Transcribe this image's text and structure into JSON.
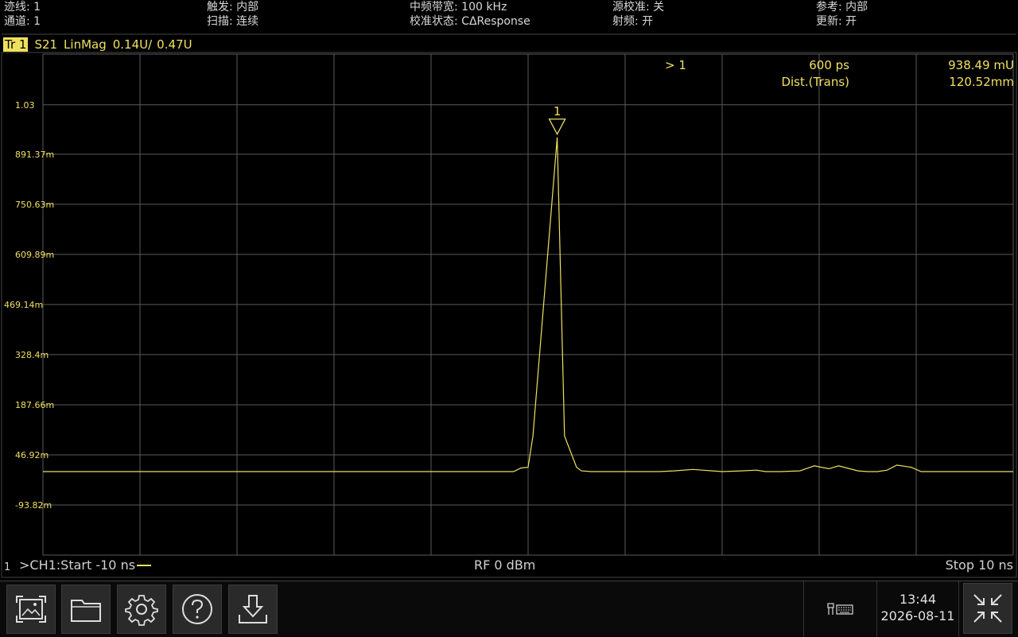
{
  "status_bar": {
    "col1": [
      "迹线: 1",
      "通道: 1"
    ],
    "col2": [
      "触发: 内部",
      "扫描: 连续"
    ],
    "col3": [
      "中频带宽: 100 kHz",
      "校准状态: CΔResponse"
    ],
    "col4": [
      "源校准: 关",
      "射频: 开"
    ],
    "col5": [
      "参考: 内部",
      "更新: 开"
    ]
  },
  "trace_header": {
    "tag": "Tr 1",
    "param": "S21",
    "format": "LinMag",
    "scale": "0.14U/",
    "ref": "0.47U"
  },
  "marker_readout": {
    "active": "> 1",
    "x": "600 ps",
    "y": "938.49 mU",
    "dist_label": "Dist.(Trans)",
    "dist_value": "120.52mm"
  },
  "footer": {
    "channel_number": "1",
    "start": ">CH1:Start -10 ns",
    "power": "RF 0 dBm",
    "stop": "Stop 10 ns"
  },
  "clock": {
    "time": "13:44",
    "date": "2026-08-11"
  },
  "colors": {
    "trace": "#f0e060",
    "grid": "#5a5a5a",
    "background": "#000000"
  },
  "icons": [
    "screenshot-icon",
    "folder-icon",
    "gear-icon",
    "help-icon",
    "download-icon",
    "keyboard-icon",
    "fullscreen-icon"
  ],
  "chart_data": {
    "type": "line",
    "xlabel": "",
    "ylabel": "",
    "xlim": [
      -10,
      10
    ],
    "x_unit": "ns",
    "ylim": [
      -0.2346,
      1.1725
    ],
    "y_unit": "U",
    "reference_value": 0.46914,
    "y_tick_labels": [
      "1.03",
      "891.37m",
      "750.63m",
      "609.89m",
      "469.14m",
      "328.4m",
      "187.66m",
      "46.92m",
      "-93.82m"
    ],
    "y_tick_values": [
      1.03,
      0.89137,
      0.75063,
      0.60989,
      0.46914,
      0.3284,
      0.18766,
      0.04692,
      -0.09382
    ],
    "grid": true,
    "series": [
      {
        "x": [
          -10,
          -0.3,
          -0.25,
          -0.15,
          0.0,
          0.1,
          0.6,
          0.75,
          1.0,
          1.1,
          1.3,
          1.5,
          2.0,
          2.4,
          2.7,
          3.0,
          3.4,
          4.0,
          4.4,
          4.7,
          4.9,
          5.2,
          5.6,
          5.9,
          6.2,
          6.4,
          6.8,
          7.0,
          7.2,
          7.4,
          7.6,
          7.9,
          8.1,
          10
        ],
        "y": [
          0,
          0,
          0.003,
          0.01,
          0.012,
          0.1,
          0.9385,
          0.1,
          0.012,
          0.002,
          0.0,
          0.0,
          0.0,
          0.0,
          0.0,
          0.002,
          0.006,
          0.0,
          0.002,
          0.004,
          0.0,
          0.0,
          0.002,
          0.016,
          0.008,
          0.016,
          0.002,
          0.0,
          0.0,
          0.004,
          0.018,
          0.012,
          0.0,
          0
        ]
      }
    ],
    "markers": [
      {
        "label": "1",
        "x": 0.6,
        "y": 0.93849
      }
    ]
  }
}
